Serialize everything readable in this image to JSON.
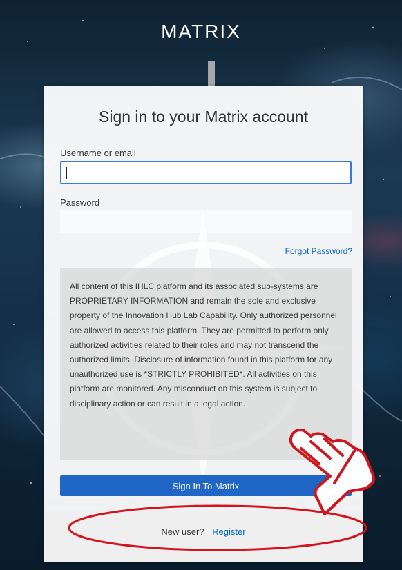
{
  "brand": {
    "name": "MATRIX"
  },
  "login": {
    "title": "Sign in to your Matrix account",
    "username_label": "Username or email",
    "username_value": "",
    "password_label": "Password",
    "password_value": "",
    "forgot_password": "Forgot Password?",
    "notice_text": "All content of this IHLC platform and its associated sub-systems are PROPRIETARY INFORMATION and remain the sole and exclusive property of the Innovation Hub Lab Capability. Only authorized personnel are allowed to access this platform. They are permitted to perform only authorized activities related to their roles and may not transcend the authorized limits. Disclosure of information found in this platform for any unauthorized use is *STRICTLY PROHIBITED*. All activities on this platform are monitored. Any misconduct on this system is subject to disciplinary action or can result in a legal action.",
    "signin_button": "Sign In To Matrix",
    "new_user_text": "New user?",
    "register_link": "Register"
  },
  "colors": {
    "primary_button": "#1f66c6",
    "link": "#0066cc",
    "focus_border": "#3a7bd5",
    "annotation": "#d2141e"
  },
  "annotation": {
    "pointer": "hand-pointer-icon",
    "highlight": "ellipse-highlight"
  }
}
